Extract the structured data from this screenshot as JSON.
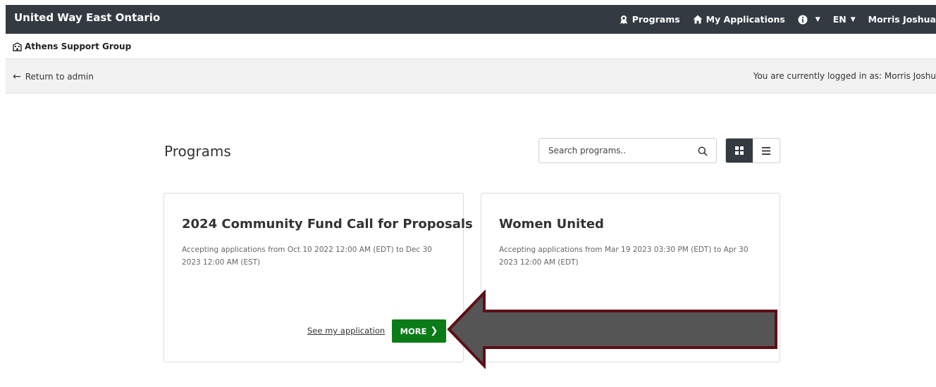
{
  "topbar": {
    "brand": "United Way East Ontario",
    "programs_label": "Programs",
    "my_applications_label": "My Applications",
    "language": "EN",
    "user_name": "Morris Joshua"
  },
  "org": {
    "name": "Athens Support Group"
  },
  "admin": {
    "return_label": "Return to admin",
    "logged_in_text": "You are currently logged in as: Morris Joshu"
  },
  "main": {
    "title": "Programs",
    "search": {
      "placeholder": "Search programs.."
    }
  },
  "cards": [
    {
      "title": "2024 Community Fund Call for Proposals",
      "description": "Accepting applications from Oct 10 2022 12:00 AM (EDT) to Dec 30 2023 12:00 AM (EST)",
      "see_application_label": "See my application",
      "more_label": "MORE"
    },
    {
      "title": "Women United",
      "description": "Accepting applications from Mar 19 2023 03:30 PM (EDT) to Apr 30 2023 12:00 AM (EDT)"
    }
  ],
  "colors": {
    "topbar": "#333a42",
    "more_button": "#0a7b17",
    "arrow_fill": "#555555",
    "arrow_outline": "#5c0f15"
  },
  "icons": {
    "programs": "award-icon",
    "my_applications": "home-icon",
    "info": "info-circle-icon",
    "org": "building-icon",
    "return": "arrow-left-icon",
    "search": "search-icon",
    "grid_view": "grid-icon",
    "list_view": "list-icon"
  }
}
